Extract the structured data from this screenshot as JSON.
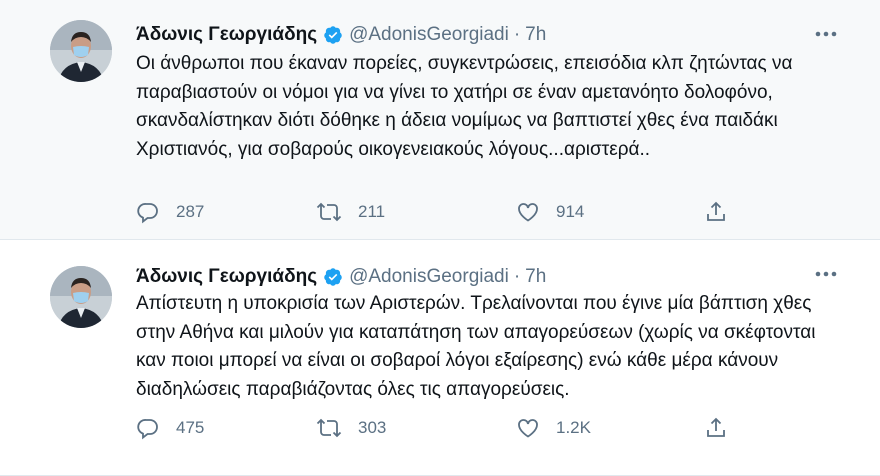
{
  "tweets": [
    {
      "author_name": "Άδωνις Γεωργιάδης",
      "handle": "@AdonisGeorgiadi",
      "separator": "·",
      "time": "7h",
      "text": "Οι άνθρωποι που έκαναν πορείες, συγκεντρώσεις, επεισόδια κλπ ζητώντας να παραβιαστούν οι νόμοι για να γίνει το χατήρι σε έναν αμετανόητο δολοφόνο, σκανδαλίστηκαν διότι δόθηκε η άδεια νομίμως να βαπτιστεί χθες ένα παιδάκι Χριστιανός, για σοβαρούς οικογενειακούς λόγους...αριστερά..",
      "replies": "287",
      "retweets": "211",
      "likes": "914"
    },
    {
      "author_name": "Άδωνις Γεωργιάδης",
      "handle": "@AdonisGeorgiadi",
      "separator": "·",
      "time": "7h",
      "text": "Απίστευτη η υποκρισία των Αριστερών. Τρελαίνονται που έγινε μία βάπτιση χθες στην Αθήνα και μιλούν για καταπάτηση των απαγορεύσεων (χωρίς να σκέφτονται καν ποιοι μπορεί να είναι οι σοβαροί λόγοι εξαίρεσης) ενώ κάθε μέρα κάνουν διαδηλώσεις παραβιάζοντας όλες τις απαγορεύσεις.",
      "replies": "475",
      "retweets": "303",
      "likes": "1.2K"
    }
  ],
  "colors": {
    "verified": "#1da1f2",
    "muted": "#5b7083",
    "text": "#0f1419",
    "first_tweet_background": "#f7f9fa"
  },
  "icons": {
    "more": "more-dots-icon",
    "verified": "verified-badge-icon",
    "reply": "reply-icon",
    "retweet": "retweet-icon",
    "like": "heart-icon",
    "share": "share-icon"
  }
}
